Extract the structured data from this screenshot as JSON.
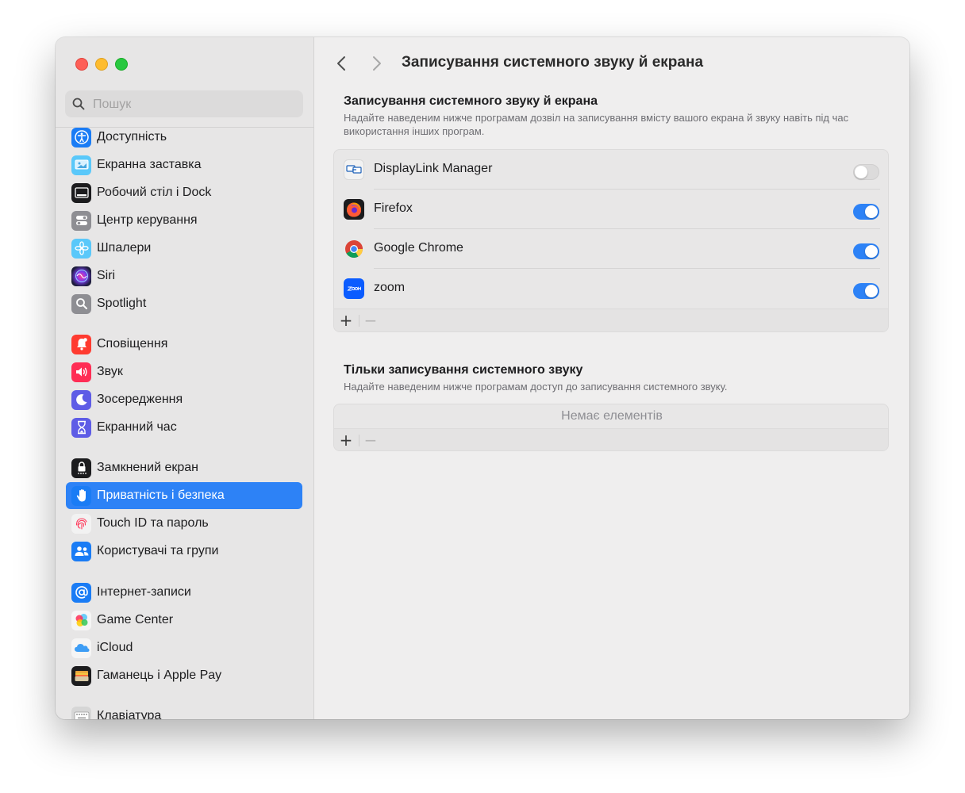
{
  "window": {
    "traffic_lights": {
      "close": "#fe5f57",
      "minimize": "#febc2e",
      "zoom": "#28c840"
    }
  },
  "sidebar": {
    "search_placeholder": "Пошук",
    "selected_color": "#2d82f6",
    "items": [
      {
        "label": "Доступність",
        "icon": "accessibility-icon"
      },
      {
        "label": "Екранна заставка",
        "icon": "screensaver-icon"
      },
      {
        "label": "Робочий стіл і Dock",
        "icon": "desktop-dock-icon"
      },
      {
        "label": "Центр керування",
        "icon": "control-center-icon"
      },
      {
        "label": "Шпалери",
        "icon": "wallpaper-icon"
      },
      {
        "label": "Siri",
        "icon": "siri-icon"
      },
      {
        "label": "Spotlight",
        "icon": "spotlight-icon"
      },
      {
        "label": "Сповіщення",
        "icon": "notifications-icon"
      },
      {
        "label": "Звук",
        "icon": "sound-icon"
      },
      {
        "label": "Зосередження",
        "icon": "focus-icon"
      },
      {
        "label": "Екранний час",
        "icon": "screen-time-icon"
      },
      {
        "label": "Замкнений екран",
        "icon": "lock-screen-icon"
      },
      {
        "label": "Приватність і безпека",
        "icon": "privacy-hand-icon",
        "selected": true
      },
      {
        "label": "Touch ID та пароль",
        "icon": "touch-id-icon"
      },
      {
        "label": "Користувачі та групи",
        "icon": "users-groups-icon"
      },
      {
        "label": "Інтернет-записи",
        "icon": "internet-accounts-icon"
      },
      {
        "label": "Game Center",
        "icon": "game-center-icon"
      },
      {
        "label": "iCloud",
        "icon": "icloud-icon"
      },
      {
        "label": "Гаманець і Apple Pay",
        "icon": "wallet-icon"
      },
      {
        "label": "Клавіатура",
        "icon": "keyboard-icon"
      }
    ]
  },
  "header": {
    "title": "Записування системного звуку й екрана"
  },
  "section_screen": {
    "title": "Записування системного звуку й екрана",
    "description": "Надайте наведеним нижче програмам дозвіл на записування вмісту вашого екрана й звуку навіть під час використання інших програм.",
    "apps": [
      {
        "name": "DisplayLink Manager",
        "icon": "displaylink-icon",
        "enabled": false
      },
      {
        "name": "Firefox",
        "icon": "firefox-icon",
        "enabled": true
      },
      {
        "name": "Google Chrome",
        "icon": "chrome-icon",
        "enabled": true
      },
      {
        "name": "zoom",
        "icon": "zoom-icon",
        "enabled": true
      }
    ],
    "add_label": "+",
    "remove_label": "−"
  },
  "section_audio": {
    "title": "Тільки записування системного звуку",
    "description": "Надайте наведеним нижче програмам доступ до записування системного звуку.",
    "empty_text": "Немає елементів",
    "add_label": "+",
    "remove_label": "−"
  }
}
